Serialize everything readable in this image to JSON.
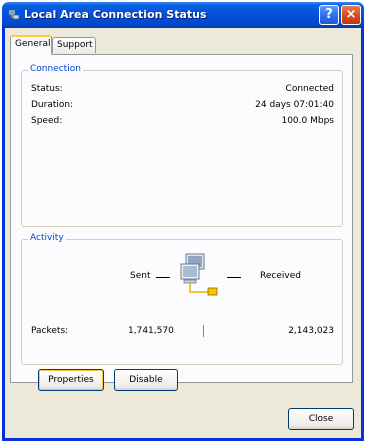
{
  "window": {
    "title": "Local Area Connection Status"
  },
  "titlebar_buttons": {
    "help": "?",
    "close": "×"
  },
  "tabs": [
    {
      "label": "General"
    },
    {
      "label": "Support"
    }
  ],
  "connection": {
    "group_title": "Connection",
    "status_label": "Status:",
    "status_value": "Connected",
    "duration_label": "Duration:",
    "duration_value": "24 days 07:01:40",
    "speed_label": "Speed:",
    "speed_value": "100.0 Mbps"
  },
  "activity": {
    "group_title": "Activity",
    "sent_label": "Sent",
    "received_label": "Received",
    "packets_label": "Packets:",
    "packets_sent": "1,741,570",
    "packets_received": "2,143,023"
  },
  "buttons": {
    "properties": "Properties",
    "disable": "Disable",
    "close": "Close"
  },
  "colors": {
    "titlebar": "#0451d9",
    "group_title": "#0046d5",
    "face": "#ece9d8"
  }
}
